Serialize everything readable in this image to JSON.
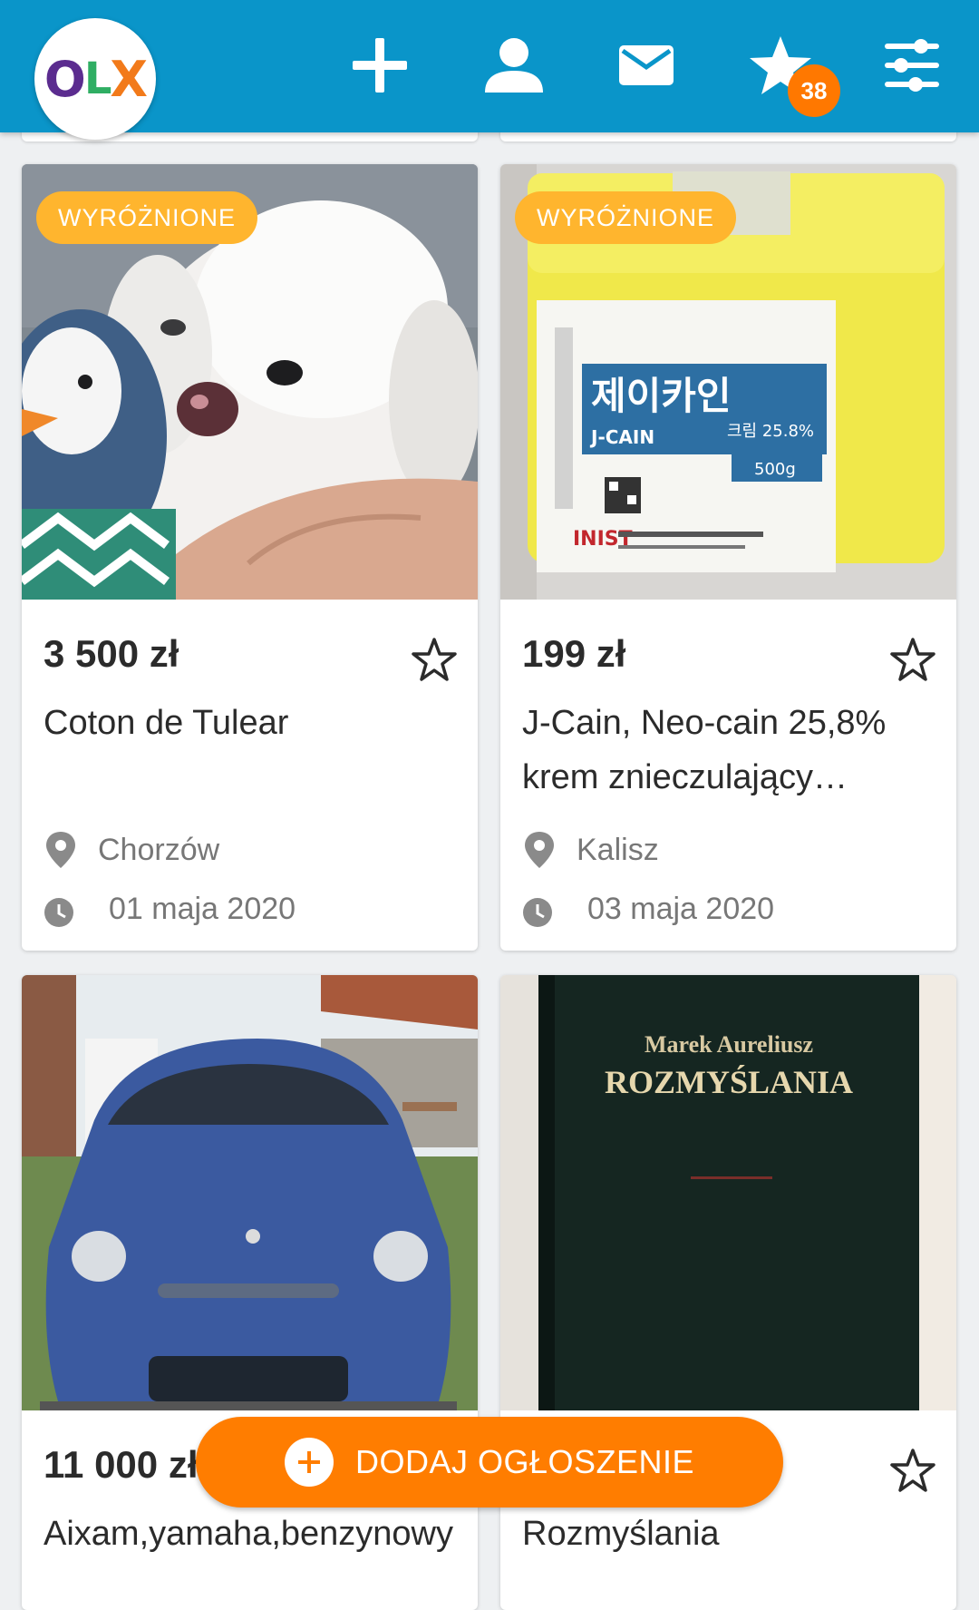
{
  "header": {
    "logo": "OLX",
    "icons": [
      "add-icon",
      "account-icon",
      "messages-icon",
      "favorites-icon",
      "filters-icon"
    ],
    "favorites_count": "38",
    "brand_color": "#0a95c9"
  },
  "listings": [
    {
      "badge": "WYRÓŻNIONE",
      "price": "3 500 zł",
      "title": "Coton de Tulear",
      "location": "Chorzów",
      "date": "01 maja 2020"
    },
    {
      "badge": "WYRÓŻNIONE",
      "price": "199 zł",
      "title": "J-Cain, Neo-cain 25,8% krem znieczulający…",
      "location": "Kalisz",
      "date": "03 maja 2020",
      "product_label": {
        "korean": "제이카인",
        "name": "J-CAIN",
        "percent": "크림 25.8%",
        "weight": "500g",
        "brand": "INIST"
      }
    },
    {
      "price": "11 000 zł",
      "title": "Aixam,yamaha,benzynowy"
    },
    {
      "title": "Rozmyślania",
      "book_author": "Marek Aureliusz",
      "book_title": "ROZMYŚLANIA"
    }
  ],
  "add_button": {
    "label": "DODAJ OGŁOSZENIE",
    "color": "#ff7d00"
  },
  "badge_color": "#ffb52e"
}
